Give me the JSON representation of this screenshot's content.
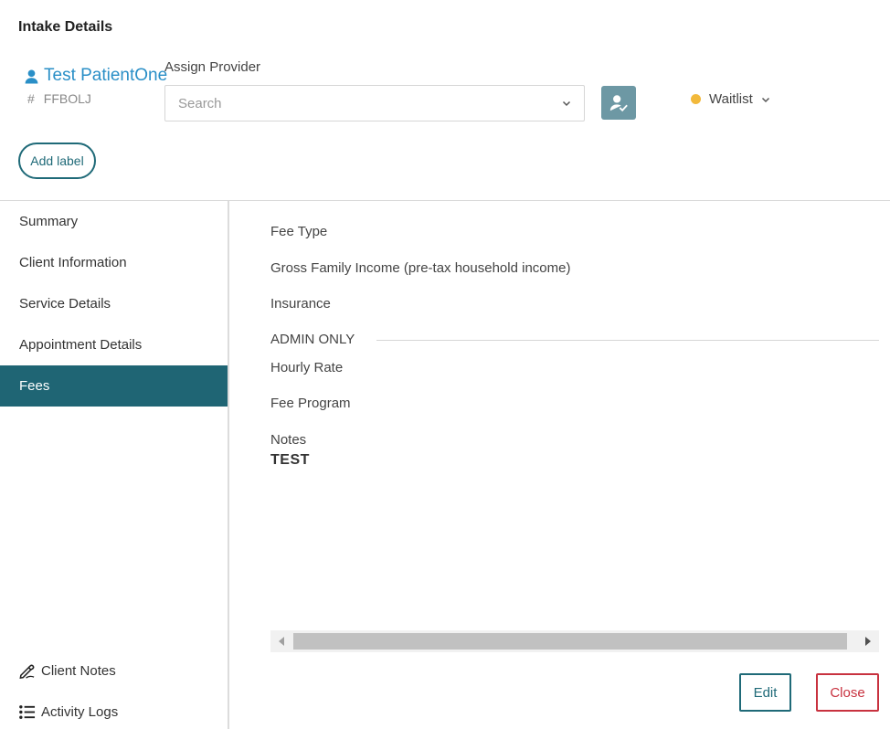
{
  "header": {
    "title": "Intake Details"
  },
  "patient": {
    "name": "Test PatientOne",
    "id_prefix": "#",
    "id": "FFBOLJ"
  },
  "assign_provider": {
    "label": "Assign Provider",
    "placeholder": "Search"
  },
  "status": {
    "label": "Waitlist",
    "color": "#f2b93b"
  },
  "add_label_button": "Add label",
  "sidebar": {
    "items": [
      {
        "label": "Summary"
      },
      {
        "label": "Client Information"
      },
      {
        "label": "Service Details"
      },
      {
        "label": "Appointment Details"
      },
      {
        "label": "Fees",
        "active": true
      }
    ],
    "bottom": [
      {
        "label": "Client Notes",
        "icon": "pen-icon"
      },
      {
        "label": "Activity Logs",
        "icon": "list-icon"
      }
    ]
  },
  "fees": {
    "fee_type": "Fee Type",
    "gross_income": "Gross Family Income (pre-tax household income)",
    "insurance": "Insurance",
    "admin_section": "ADMIN ONLY",
    "hourly_rate": "Hourly Rate",
    "fee_program": "Fee Program",
    "notes_label": "Notes",
    "notes_value": "TEST"
  },
  "actions": {
    "edit": "Edit",
    "close": "Close"
  },
  "colors": {
    "accent": "#1f6574",
    "link": "#2a8fc7",
    "danger": "#c8323f"
  }
}
